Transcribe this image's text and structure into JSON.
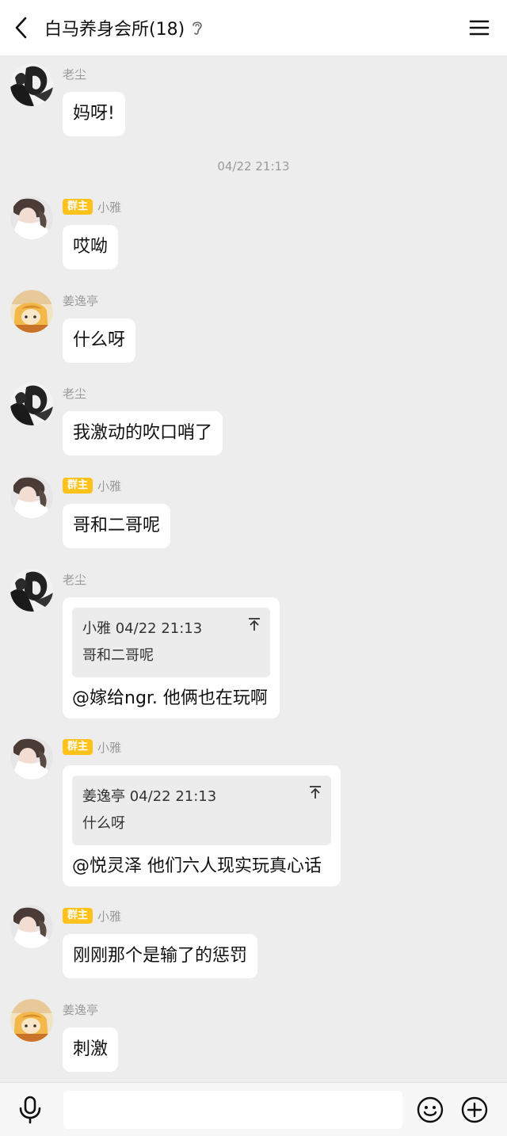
{
  "header": {
    "title": "白马养身会所(18)"
  },
  "chat": {
    "timestamp": "04/22 21:13",
    "messages": [
      {
        "sender": "老尘",
        "badge": "",
        "text": "妈呀!"
      },
      {
        "sender": "小雅",
        "badge": "群主",
        "text": "哎呦"
      },
      {
        "sender": "姜逸亭",
        "badge": "",
        "text": "什么呀"
      },
      {
        "sender": "老尘",
        "badge": "",
        "text": "我激动的吹口哨了"
      },
      {
        "sender": "小雅",
        "badge": "群主",
        "text": "哥和二哥呢"
      },
      {
        "sender": "老尘",
        "badge": "",
        "quote_header": "小雅 04/22 21:13",
        "quote_text": "哥和二哥呢",
        "text": "@嫁给ngr. 他俩也在玩啊"
      },
      {
        "sender": "小雅",
        "badge": "群主",
        "quote_header": "姜逸亭 04/22 21:13",
        "quote_text": "什么呀",
        "text": "@悦灵泽 他们六人现实玩真心话"
      },
      {
        "sender": "小雅",
        "badge": "群主",
        "text": "刚刚那个是输了的惩罚"
      },
      {
        "sender": "姜逸亭",
        "badge": "",
        "text": "刺激"
      }
    ]
  },
  "input": {
    "placeholder": ""
  },
  "colors": {
    "background": "#ededed",
    "bubble": "#ffffff",
    "badge": "#ffc21a",
    "meta_text": "#9a9a9a"
  },
  "icons": [
    "back-arrow-icon",
    "ear-icon",
    "menu-icon",
    "pin-top-icon",
    "microphone-icon",
    "emoji-icon",
    "plus-circle-icon",
    "avatar-laochen",
    "avatar-xiaoya",
    "avatar-jiangyiting"
  ]
}
